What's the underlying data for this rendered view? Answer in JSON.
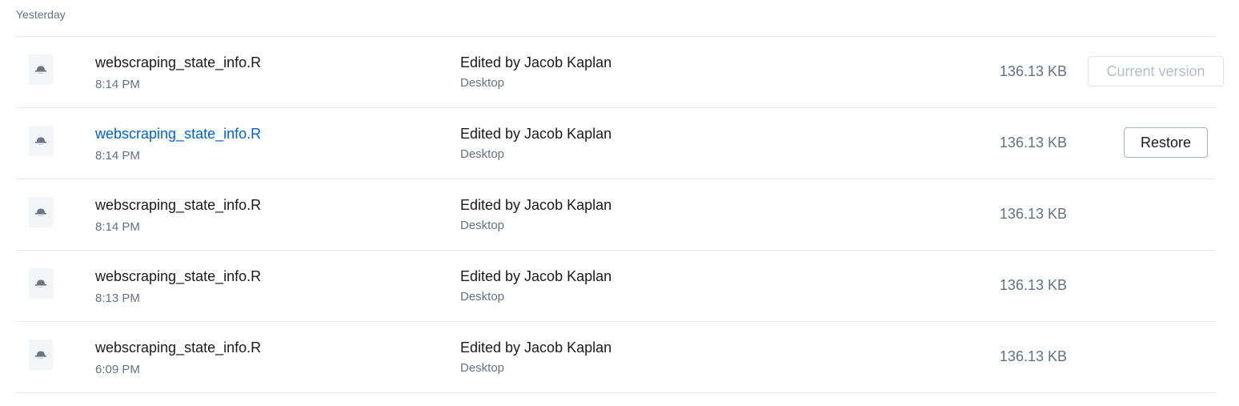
{
  "section": {
    "label": "Yesterday"
  },
  "versions": [
    {
      "filename": "webscraping_state_info.R",
      "time": "8:14 PM",
      "editor": "Edited by Jacob Kaplan",
      "device": "Desktop",
      "size": "136.13 KB",
      "action": "Current version"
    },
    {
      "filename": "webscraping_state_info.R",
      "time": "8:14 PM",
      "editor": "Edited by Jacob Kaplan",
      "device": "Desktop",
      "size": "136.13 KB",
      "action": "Restore"
    },
    {
      "filename": "webscraping_state_info.R",
      "time": "8:14 PM",
      "editor": "Edited by Jacob Kaplan",
      "device": "Desktop",
      "size": "136.13 KB"
    },
    {
      "filename": "webscraping_state_info.R",
      "time": "8:13 PM",
      "editor": "Edited by Jacob Kaplan",
      "device": "Desktop",
      "size": "136.13 KB"
    },
    {
      "filename": "webscraping_state_info.R",
      "time": "6:09 PM",
      "editor": "Edited by Jacob Kaplan",
      "device": "Desktop",
      "size": "136.13 KB"
    }
  ],
  "icons": {
    "file": "r-file-icon"
  },
  "colors": {
    "link": "#0061d5",
    "muted": "#637282",
    "divider": "#e6e8eb"
  }
}
